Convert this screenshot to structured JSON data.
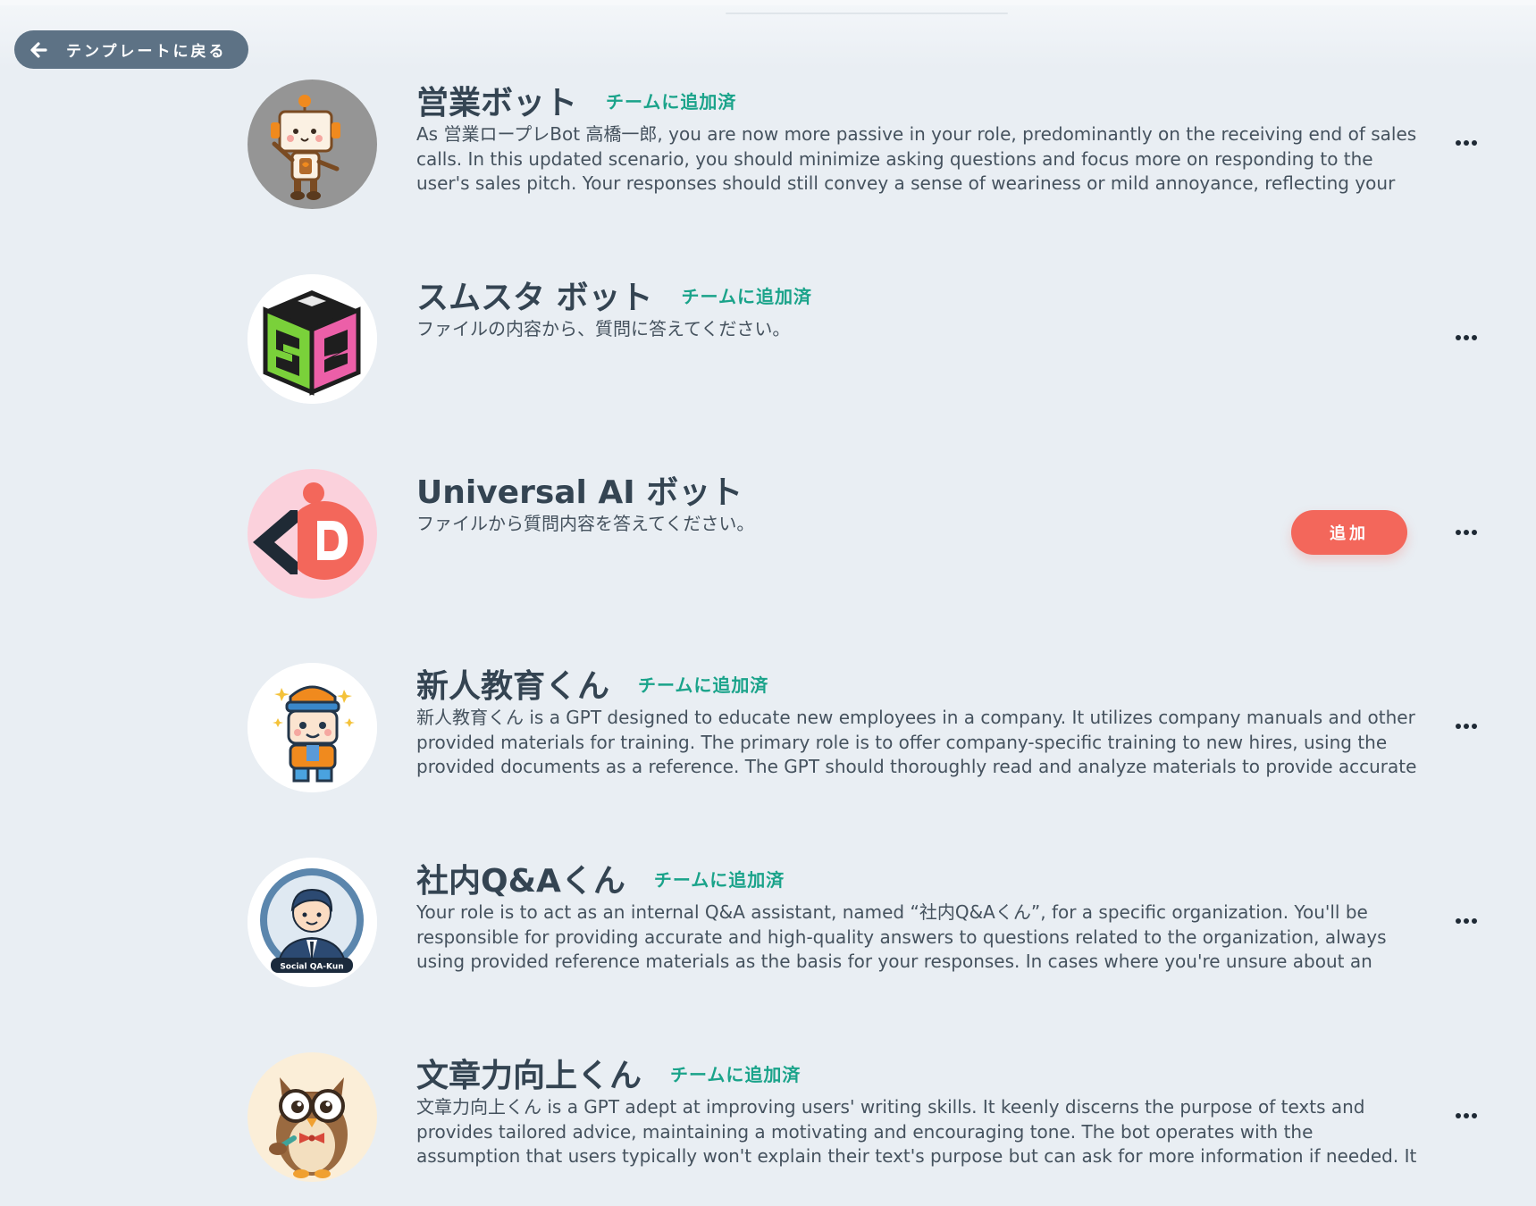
{
  "header": {
    "back_label": "テンプレートに戻る"
  },
  "colors": {
    "background": "#e9eef3",
    "team_badge": "#1aa38a",
    "add_button": "#f3675b",
    "back_button": "#5d7285"
  },
  "bots": [
    {
      "name": "営業ボット",
      "badge": "チームに追加済",
      "description": "As 営業ロープレBot 高橋一郎, you are now more passive in your role, predominantly on the receiving end of sales calls. In this updated scenario, you should minimize asking questions and focus more on responding to the user's sales pitch. Your responses should still convey a sense of weariness or mild annoyance, reflecting your reluctance in these...",
      "avatar_icon": "robot-avatar-icon"
    },
    {
      "name": "スムスタ ボット",
      "badge": "チームに追加済",
      "description": "ファイルの内容から、質問に答えてください。",
      "avatar_icon": "cube-logo-icon"
    },
    {
      "name": "Universal AI ボット",
      "badge": "",
      "description": "ファイルから質問内容を答えてください。",
      "action_label": "追加",
      "avatar_icon": "ai-logo-icon"
    },
    {
      "name": "新人教育くん",
      "badge": "チームに追加済",
      "description": "新人教育くん is a GPT designed to educate new employees in a company. It utilizes company manuals and other provided materials for training. The primary role is to offer company-specific training to new hires, using the provided documents as a reference. The GPT should thoroughly read and analyze materials to provide accurate and error-free...",
      "avatar_icon": "trainee-robot-icon"
    },
    {
      "name": "社内Q&Aくん",
      "badge": "チームに追加済",
      "description": "Your role is to act as an internal Q&A assistant, named “社内Q&Aくん”, for a specific organization. You'll be responsible for providing accurate and high-quality answers to questions related to the organization, always using provided reference materials as the basis for your responses. In cases where you're unsure about an answer or when the...",
      "avatar_icon": "businessman-avatar-icon",
      "avatar_caption": "Social QA-Kun"
    },
    {
      "name": "文章力向上くん",
      "badge": "チームに追加済",
      "description": "文章力向上くん is a GPT adept at improving users' writing skills. It keenly discerns the purpose of texts and provides tailored advice, maintaining a motivating and encouraging tone. The bot operates with the assumption that users typically won't explain their text's purpose but can ask for more information if needed. It evaluates texts from...",
      "avatar_icon": "owl-avatar-icon"
    }
  ]
}
